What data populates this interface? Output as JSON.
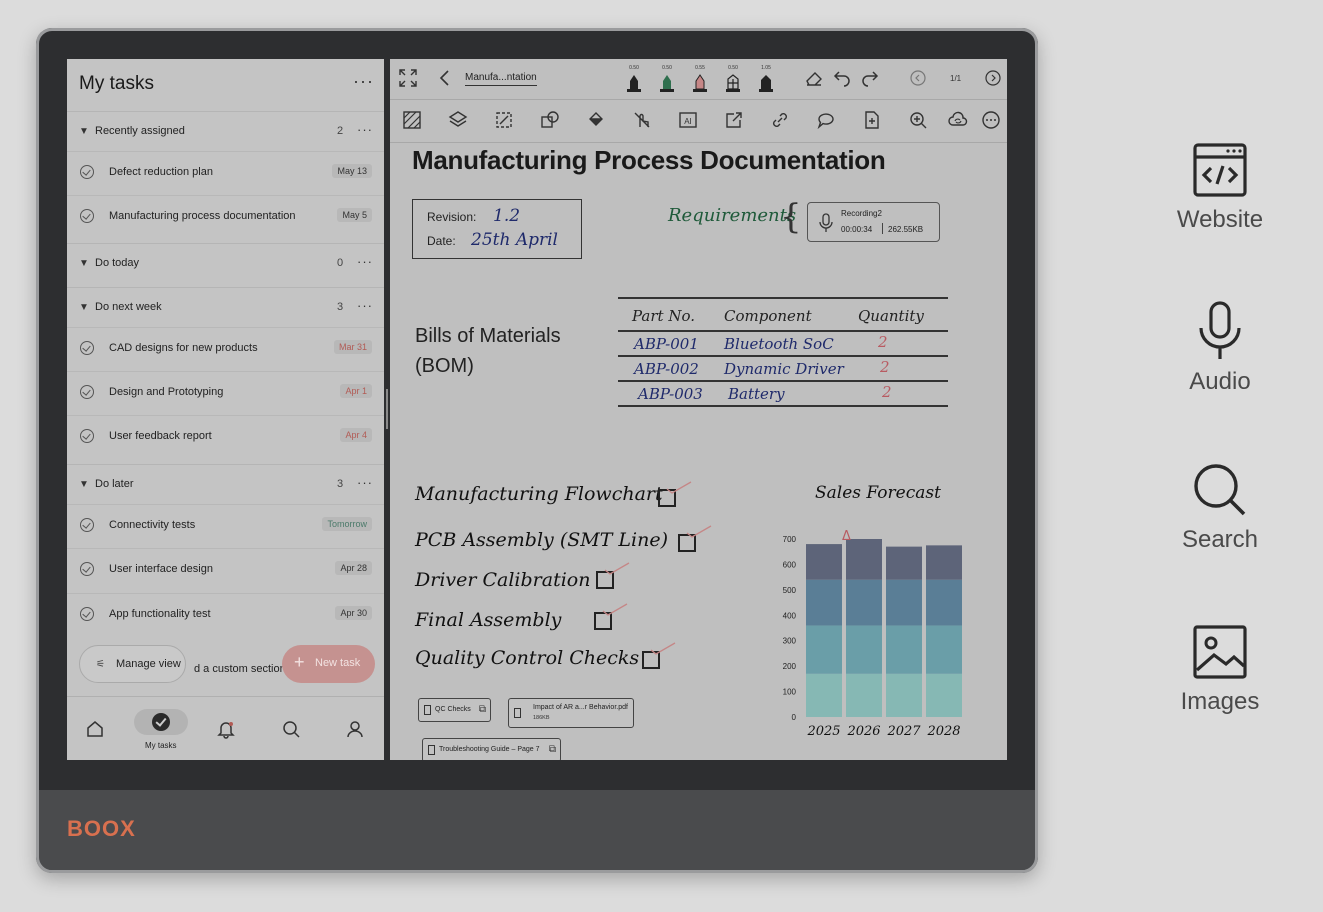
{
  "brand": "BOOX",
  "tasks_app": {
    "title": "My tasks",
    "more": "···",
    "sections": [
      {
        "label": "Recently assigned",
        "count": "2",
        "dots": "···",
        "tasks": [
          {
            "name": "Defect reduction plan",
            "date": "May 13",
            "tone": "normal"
          },
          {
            "name": "Manufacturing process documentation",
            "date": "May 5",
            "tone": "normal"
          }
        ]
      },
      {
        "label": "Do today",
        "count": "0",
        "dots": "···",
        "tasks": []
      },
      {
        "label": "Do next week",
        "count": "3",
        "dots": "···",
        "tasks": [
          {
            "name": "CAD designs for new products",
            "date": "Mar 31",
            "tone": "red"
          },
          {
            "name": "Design and Prototyping",
            "date": "Apr 1",
            "tone": "red"
          },
          {
            "name": "User feedback report",
            "date": "Apr 4",
            "tone": "red"
          }
        ]
      },
      {
        "label": "Do later",
        "count": "3",
        "dots": "···",
        "tasks": [
          {
            "name": "Connectivity tests",
            "date": "Tomorrow",
            "tone": "green"
          },
          {
            "name": "User interface design",
            "date": "Apr 28",
            "tone": "normal"
          },
          {
            "name": "App functionality test",
            "date": "Apr 30",
            "tone": "normal"
          }
        ]
      }
    ],
    "manage_view": "Manage view",
    "add_custom_section": "d a custom section",
    "new_task": "New task",
    "nav_active_label": "My tasks"
  },
  "notes_app": {
    "doc_title": "Manufa...ntation",
    "pen_sizes": [
      "0.50",
      "0.50",
      "0.55",
      "0.50",
      "1.05"
    ],
    "page": "1/1",
    "heading": "Manufacturing Process Documentation",
    "revision_label": "Revision:",
    "revision_value": "1.2",
    "date_label": "Date:",
    "date_value": "25th April",
    "requirements": "Requirements",
    "recording": {
      "name": "Recording2",
      "duration": "00:00:34",
      "size": "262.55KB"
    },
    "bom_title_1": "Bills of Materials",
    "bom_title_2": "(BOM)",
    "bom_headers": [
      "Part No.",
      "Component",
      "Quantity"
    ],
    "bom_rows": [
      [
        "ABP-001",
        "Bluetooth SoC",
        "2"
      ],
      [
        "ABP-002",
        "Dynamic Driver",
        "2"
      ],
      [
        "ABP-003",
        "Battery",
        "2"
      ]
    ],
    "checklist": [
      "Manufacturing Flowchart",
      "PCB Assembly (SMT Line)",
      "Driver Calibration",
      "Final Assembly",
      "Quality Control Checks"
    ],
    "attachments": [
      {
        "name": "QC Checks"
      },
      {
        "name": "Impact of AR a...r Behavior.pdf",
        "size": "186KB"
      },
      {
        "name": "Troubleshooting Guide – Page 7"
      }
    ]
  },
  "chart_data": {
    "type": "bar",
    "title": "Sales Forecast",
    "categories": [
      "2025",
      "2026",
      "2027",
      "2028"
    ],
    "stacked": true,
    "series": [
      {
        "values": [
          170,
          170,
          170,
          170
        ]
      },
      {
        "values": [
          190,
          190,
          190,
          190
        ]
      },
      {
        "values": [
          180,
          180,
          180,
          180
        ]
      },
      {
        "values": [
          140,
          160,
          130,
          135
        ]
      }
    ],
    "ylim": [
      0,
      700
    ],
    "yticks": [
      0,
      100,
      200,
      300,
      400,
      500,
      600,
      700
    ],
    "annotation": "Δ",
    "colors": [
      "#86b8b4",
      "#6a9ea8",
      "#5a7e96",
      "#5d6479"
    ]
  },
  "features": [
    {
      "label": "Website",
      "icon": "code-window-icon"
    },
    {
      "label": "Audio",
      "icon": "microphone-icon"
    },
    {
      "label": "Search",
      "icon": "search-icon"
    },
    {
      "label": "Images",
      "icon": "image-icon"
    }
  ]
}
